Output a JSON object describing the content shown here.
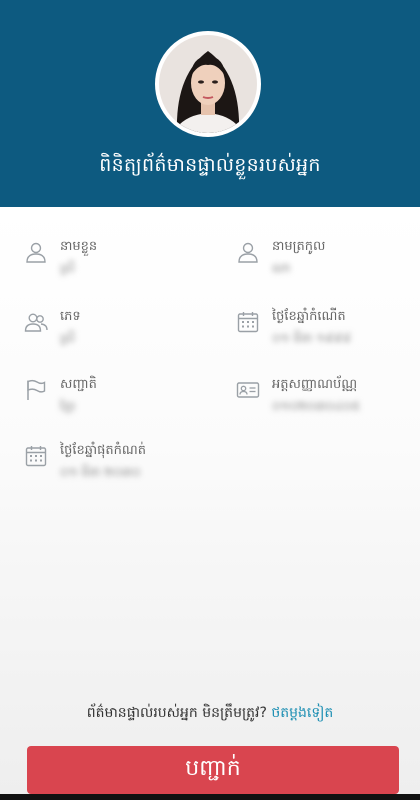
{
  "header": {
    "title": "ពិនិត្យព័ត៌មានផ្ទាល់ខ្លួនរបស់អ្នក"
  },
  "fields": [
    {
      "label": "នាមខ្លួន",
      "value": "ស្រី",
      "icon": "person-icon"
    },
    {
      "label": "នាមត្រកូល",
      "value": "ណា",
      "icon": "person-icon"
    },
    {
      "label": "ភេទ",
      "value": "ស្រី",
      "icon": "people-icon"
    },
    {
      "label": "ថ្ងៃខែឆ្នាំកំណើត",
      "value": "០១ មីនា ១៩៩៨",
      "icon": "calendar-icon"
    },
    {
      "label": "សញ្ជាតិ",
      "value": "ខ្មែរ",
      "icon": "flag-icon"
    },
    {
      "label": "អត្តសញ្ញាណប័ណ្ណ",
      "value": "០១០២០៣០៤០៥",
      "icon": "id-card-icon"
    },
    {
      "label": "ថ្ងៃខែឆ្នាំផុតកំណត់",
      "value": "០១ មីនា ២០៣០",
      "icon": "calendar-icon"
    }
  ],
  "footer": {
    "question": "ព័ត៌មានផ្ទាល់របស់អ្នក មិនត្រឹមត្រូវ?",
    "link": "ថតម្តងទៀត"
  },
  "confirm_button": "បញ្ជាក់",
  "colors": {
    "header_bg": "#0d5a80",
    "button_bg": "#d9454f",
    "link": "#1d8fb3"
  }
}
